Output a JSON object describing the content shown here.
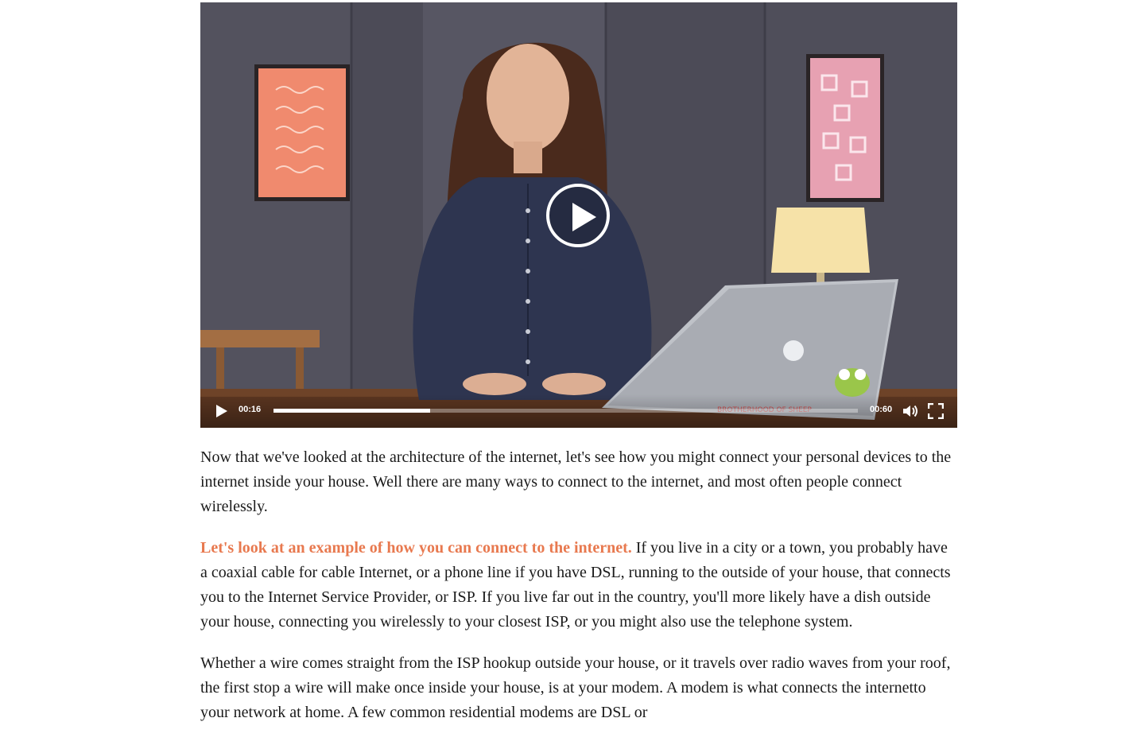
{
  "player": {
    "current_time": "00:16",
    "duration": "00:60",
    "progress": 0.268,
    "play_icon": "play-icon",
    "volume_icon": "volume-icon",
    "fullscreen_icon": "fullscreen-icon"
  },
  "article": {
    "paragraph1": "Now that we've looked at the architecture of the internet, let's see how you might connect your personal devices to the internet inside your house. Well there are many ways to connect to the internet, and most often people connect wirelessly.",
    "paragraph2_highlight": "Let's look at an example of how you can connect to the internet.",
    "paragraph2_rest": " If you live in a city or a town, you probably have a coaxial cable for cable Internet, or a phone line if you have DSL, running to the outside of your house, that connects you to the Internet Service Provider, or ISP. If you live far out in the country, you'll more likely have a dish outside your house, connecting you wirelessly to your closest ISP, or you might also use the telephone system.",
    "paragraph3": "Whether a wire comes straight from the ISP hookup outside your house, or it travels over radio waves from your roof, the first stop a wire will make once inside your house, is at your modem. A modem is what connects the internetto your network at home. A few common residential modems are DSL or"
  },
  "colors": {
    "highlight": "#e8794f"
  }
}
